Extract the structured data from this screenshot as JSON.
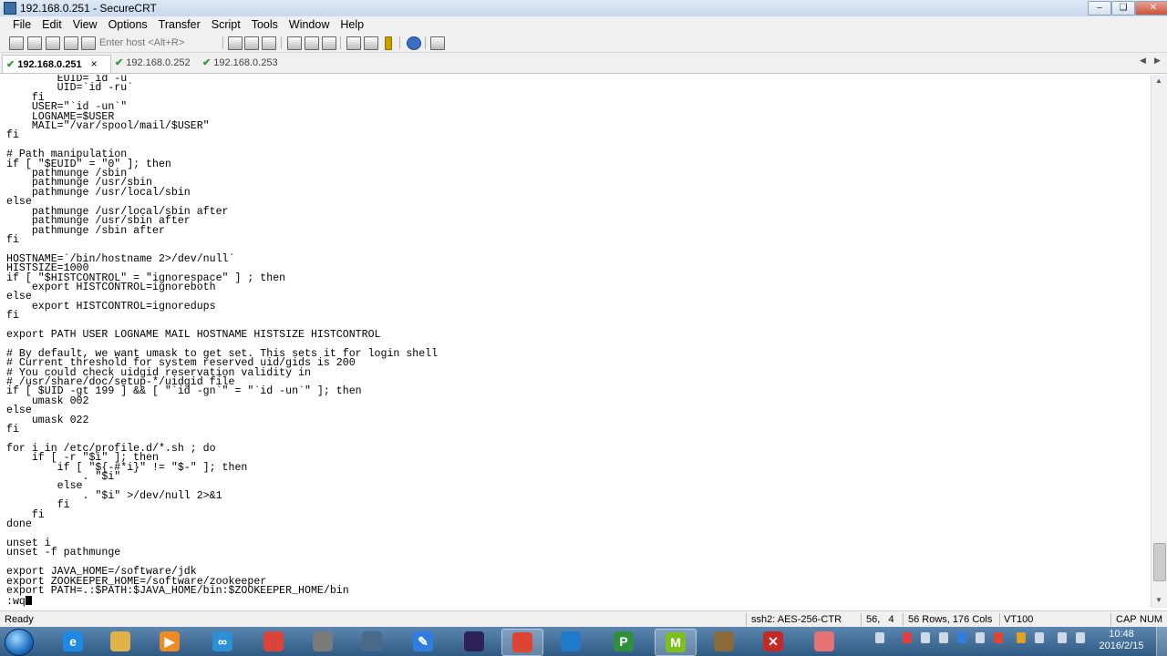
{
  "window": {
    "title": "192.168.0.251 - SecureCRT"
  },
  "menu": [
    "File",
    "Edit",
    "View",
    "Options",
    "Transfer",
    "Script",
    "Tools",
    "Window",
    "Help"
  ],
  "toolbar": {
    "host_placeholder": "Enter host <Alt+R>",
    "icons": [
      "connect-icon",
      "quick-connect-icon",
      "connect-tab-icon",
      "reconnect-icon",
      "disconnect-icon",
      "copy-icon",
      "paste-icon",
      "find-icon",
      "print-icon",
      "print-selection-icon",
      "print-setup-icon",
      "session-options-icon",
      "global-options-icon",
      "keymap-icon",
      "help-icon",
      "map-icon"
    ]
  },
  "tabs": [
    {
      "label": "192.168.0.251",
      "active": true,
      "close": "×"
    },
    {
      "label": "192.168.0.252",
      "active": false
    },
    {
      "label": "192.168.0.253",
      "active": false
    }
  ],
  "terminal": {
    "lines": [
      "        EUID=`id -u`",
      "        UID=`id -ru`",
      "    fi",
      "    USER=\"`id -un`\"",
      "    LOGNAME=$USER",
      "    MAIL=\"/var/spool/mail/$USER\"",
      "fi",
      "",
      "# Path manipulation",
      "if [ \"$EUID\" = \"0\" ]; then",
      "    pathmunge /sbin",
      "    pathmunge /usr/sbin",
      "    pathmunge /usr/local/sbin",
      "else",
      "    pathmunge /usr/local/sbin after",
      "    pathmunge /usr/sbin after",
      "    pathmunge /sbin after",
      "fi",
      "",
      "HOSTNAME=`/bin/hostname 2>/dev/null`",
      "HISTSIZE=1000",
      "if [ \"$HISTCONTROL\" = \"ignorespace\" ] ; then",
      "    export HISTCONTROL=ignoreboth",
      "else",
      "    export HISTCONTROL=ignoredups",
      "fi",
      "",
      "export PATH USER LOGNAME MAIL HOSTNAME HISTSIZE HISTCONTROL",
      "",
      "# By default, we want umask to get set. This sets it for login shell",
      "# Current threshold for system reserved uid/gids is 200",
      "# You could check uidgid reservation validity in",
      "# /usr/share/doc/setup-*/uidgid file",
      "if [ $UID -gt 199 ] && [ \"`id -gn`\" = \"`id -un`\" ]; then",
      "    umask 002",
      "else",
      "    umask 022",
      "fi",
      "",
      "for i in /etc/profile.d/*.sh ; do",
      "    if [ -r \"$i\" ]; then",
      "        if [ \"${-#*i}\" != \"$-\" ]; then",
      "            . \"$i\"",
      "        else",
      "            . \"$i\" >/dev/null 2>&1",
      "        fi",
      "    fi",
      "done",
      "",
      "unset i",
      "unset -f pathmunge",
      "",
      "export JAVA_HOME=/software/jdk",
      "export ZOOKEEPER_HOME=/software/zookeeper",
      "export PATH=.:$PATH:$JAVA_HOME/bin:$ZOOKEEPER_HOME/bin"
    ],
    "command_line": ":wq"
  },
  "status": {
    "ready": "Ready",
    "cipher": "ssh2: AES-256-CTR",
    "position": "56,   4",
    "size": "56 Rows, 176 Cols",
    "emulation": "VT100",
    "caps": "CAP",
    "num": "NUM"
  },
  "taskbar": {
    "apps": [
      {
        "name": "internet-explorer-icon",
        "color": "#1e88e5",
        "glyph": "e"
      },
      {
        "name": "file-explorer-icon",
        "color": "#e0b24a",
        "glyph": ""
      },
      {
        "name": "media-player-icon",
        "color": "#f08a24",
        "glyph": "▶"
      },
      {
        "name": "network-app-icon",
        "color": "#2d8fd5",
        "glyph": "∞"
      },
      {
        "name": "chrome-icon",
        "color": "#db4437",
        "glyph": ""
      },
      {
        "name": "settings-app-icon",
        "color": "#7a7a7a",
        "glyph": ""
      },
      {
        "name": "toolbox-app-icon",
        "color": "#4a6a8a",
        "glyph": ""
      },
      {
        "name": "feather-app-icon",
        "color": "#2f7de1",
        "glyph": "✎"
      },
      {
        "name": "eclipse-icon",
        "color": "#2c2255",
        "glyph": ""
      },
      {
        "name": "securecrt-task-icon",
        "color": "#d43",
        "glyph": ""
      },
      {
        "name": "vm-app-icon",
        "color": "#1f7ac9",
        "glyph": ""
      },
      {
        "name": "project-app-icon",
        "color": "#2f8f3a",
        "glyph": "P"
      },
      {
        "name": "mindmap-app-icon",
        "color": "#7cbf1e",
        "glyph": "M"
      },
      {
        "name": "archive-app-icon",
        "color": "#8a6a3a",
        "glyph": ""
      },
      {
        "name": "pdf-app-icon",
        "color": "#c62828",
        "glyph": "✕"
      },
      {
        "name": "eraser-app-icon",
        "color": "#e57373",
        "glyph": ""
      }
    ],
    "time": "10:48",
    "date": "2016/2/15"
  }
}
